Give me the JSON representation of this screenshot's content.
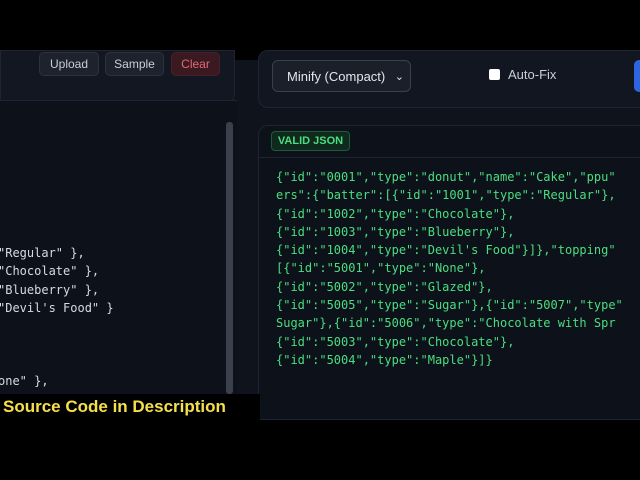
{
  "toolbar": {
    "upload": "Upload",
    "sample": "Sample",
    "clear": "Clear"
  },
  "editor": {
    "lines": [
      "\"Regular\" },",
      "\"Chocolate\" },",
      "\"Blueberry\" },",
      "\"Devil's Food\" }",
      "",
      "",
      "",
      "one\" },"
    ]
  },
  "controls": {
    "mode": "Minify (Compact)",
    "autofix": "Auto-Fix",
    "autofix_checked": false
  },
  "output": {
    "status": "VALID JSON",
    "lines": [
      "{\"id\":\"0001\",\"type\":\"donut\",\"name\":\"Cake\",\"ppu\"",
      "ers\":{\"batter\":[{\"id\":\"1001\",\"type\":\"Regular\"},",
      "{\"id\":\"1002\",\"type\":\"Chocolate\"},",
      "{\"id\":\"1003\",\"type\":\"Blueberry\"},",
      "{\"id\":\"1004\",\"type\":\"Devil's Food\"}]},\"topping\"",
      "[{\"id\":\"5001\",\"type\":\"None\"},",
      "{\"id\":\"5002\",\"type\":\"Glazed\"},",
      "{\"id\":\"5005\",\"type\":\"Sugar\"},{\"id\":\"5007\",\"type\"",
      "Sugar\"},{\"id\":\"5006\",\"type\":\"Chocolate with Spr",
      "{\"id\":\"5003\",\"type\":\"Chocolate\"},",
      "{\"id\":\"5004\",\"type\":\"Maple\"}]}"
    ]
  },
  "caption": "Source Code in  Description"
}
